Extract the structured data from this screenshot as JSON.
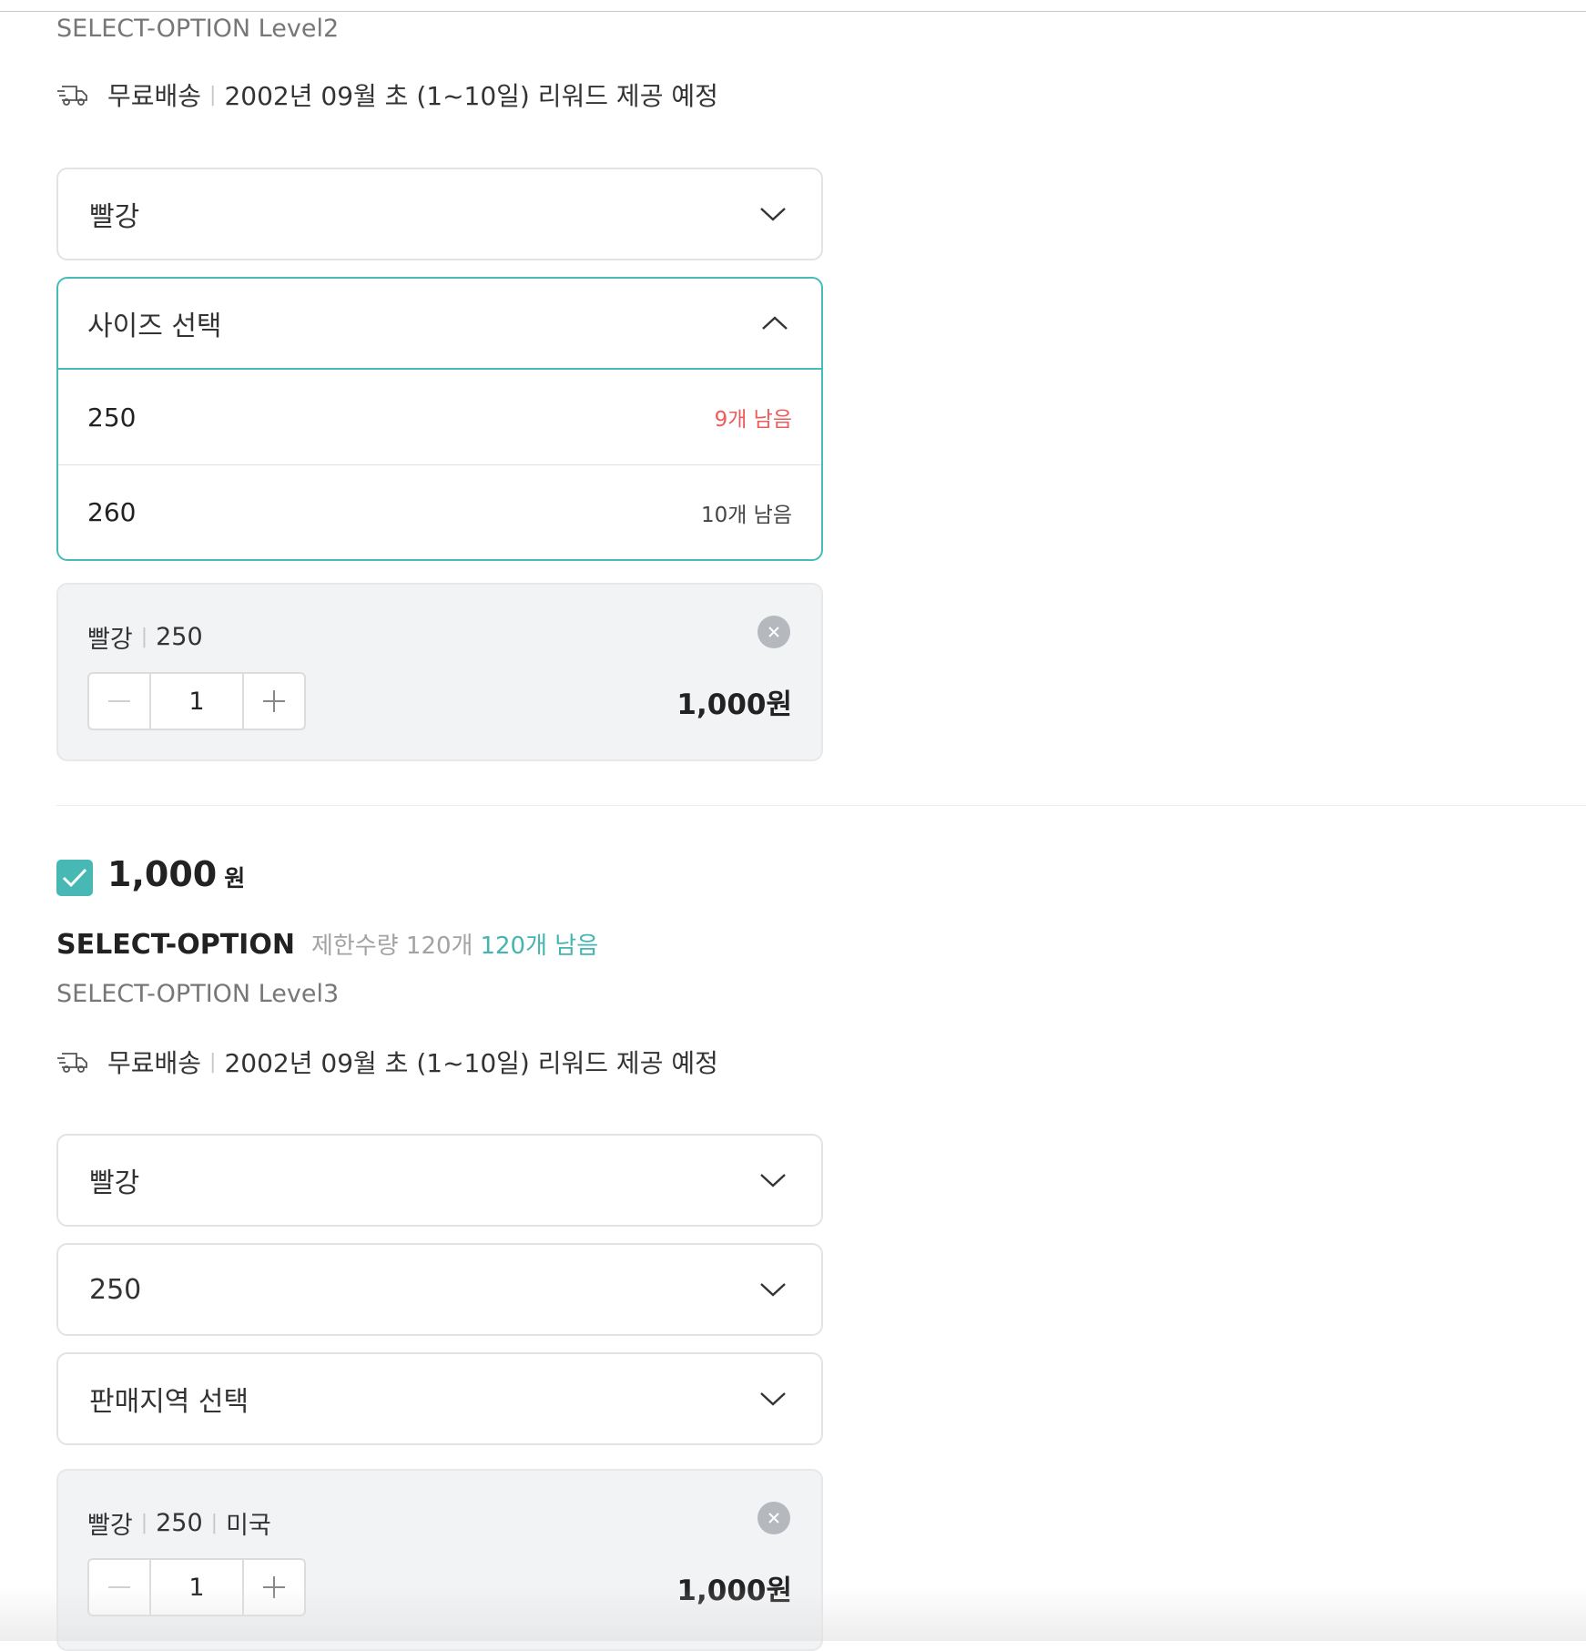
{
  "products": [
    {
      "subtitle": "SELECT-OPTION Level2",
      "shipping": {
        "method": "무료배송",
        "schedule": "2002년 09월 초 (1~10일) 리워드 제공 예정"
      },
      "color_select": {
        "value": "빨강"
      },
      "size_dropdown": {
        "label": "사이즈 선택",
        "options": [
          {
            "label": "250",
            "stock": "9개 남음"
          },
          {
            "label": "260",
            "stock": "10개 남음"
          }
        ]
      },
      "selected_item": {
        "color": "빨강",
        "size": "250",
        "quantity": "1",
        "price": "1,000원"
      }
    },
    {
      "price": "1,000",
      "price_unit": "원",
      "name": "SELECT-OPTION",
      "limit": "제한수량 120개",
      "remaining": "120개 남음",
      "subtitle": "SELECT-OPTION Level3",
      "shipping": {
        "method": "무료배송",
        "schedule": "2002년 09월 초 (1~10일) 리워드 제공 예정"
      },
      "color_select": {
        "value": "빨강"
      },
      "size_select": {
        "value": "250"
      },
      "region_select": {
        "value": "판매지역 선택"
      },
      "selected_item": {
        "color": "빨강",
        "size": "250",
        "region": "미국",
        "quantity": "1",
        "price": "1,000원"
      }
    }
  ],
  "colors": {
    "accent": "#45bcb7",
    "stock_low": "#ef5b5b",
    "card_bg": "#f2f3f5"
  }
}
